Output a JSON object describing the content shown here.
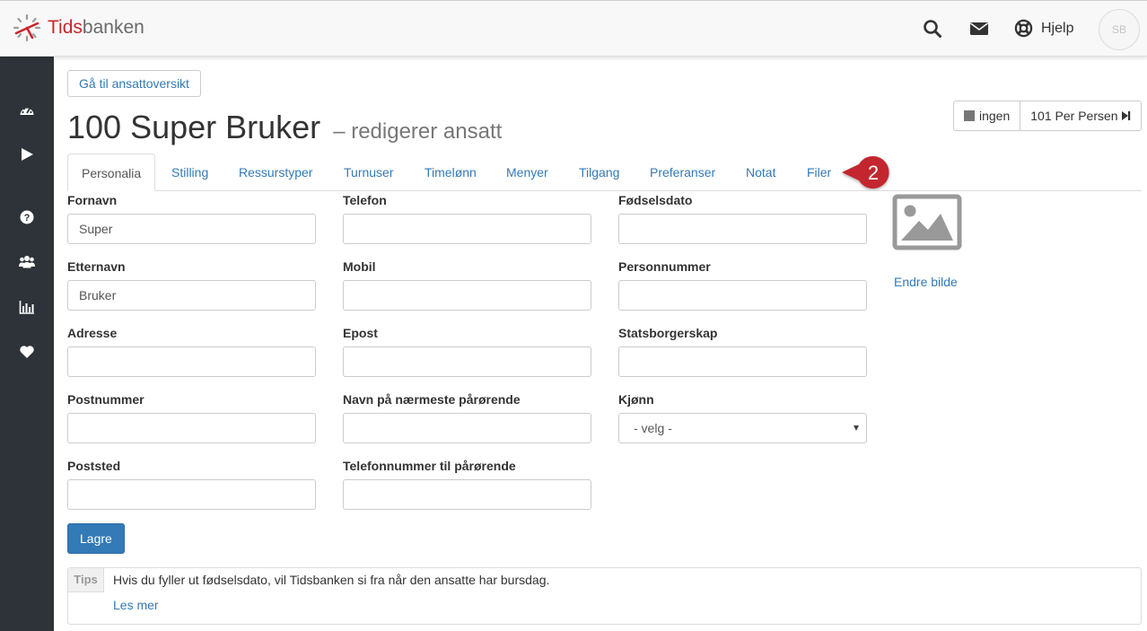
{
  "brand": {
    "name_part1": "Tids",
    "name_part2": "banken",
    "accent": "#c9252c"
  },
  "header": {
    "search_icon": "search-icon",
    "mail_icon": "envelope-icon",
    "help_icon": "lifebuoy-icon",
    "help_label": "Hjelp",
    "avatar_initials": "SB"
  },
  "sidebar": {
    "items": [
      {
        "icon": "dashboard-icon"
      },
      {
        "icon": "play-icon"
      },
      {
        "icon": "question-icon"
      },
      {
        "icon": "users-icon"
      },
      {
        "icon": "bar-chart-icon"
      },
      {
        "icon": "heart-icon"
      }
    ],
    "background": "#2d3338"
  },
  "page": {
    "back_button": "Gå til ansattoversikt",
    "title": "100 Super Bruker",
    "subtitle": "– redigerer ansatt",
    "nav_prev": "ingen",
    "nav_next": "101 Per Persen"
  },
  "tabs": [
    {
      "label": "Personalia",
      "active": true
    },
    {
      "label": "Stilling"
    },
    {
      "label": "Ressurstyper"
    },
    {
      "label": "Turnuser"
    },
    {
      "label": "Timelønn"
    },
    {
      "label": "Menyer"
    },
    {
      "label": "Tilgang"
    },
    {
      "label": "Preferanser"
    },
    {
      "label": "Notat"
    },
    {
      "label": "Filer"
    }
  ],
  "callout": {
    "number": "2",
    "color": "#c3262e"
  },
  "form": {
    "fornavn": {
      "label": "Fornavn",
      "value": "Super"
    },
    "etternavn": {
      "label": "Etternavn",
      "value": "Bruker"
    },
    "adresse": {
      "label": "Adresse",
      "value": ""
    },
    "postnummer": {
      "label": "Postnummer",
      "value": ""
    },
    "poststed": {
      "label": "Poststed",
      "value": ""
    },
    "telefon": {
      "label": "Telefon",
      "value": ""
    },
    "mobil": {
      "label": "Mobil",
      "value": ""
    },
    "epost": {
      "label": "Epost",
      "value": ""
    },
    "parorende": {
      "label": "Navn på nærmeste pårørende",
      "value": ""
    },
    "parorende_tlf": {
      "label": "Telefonnummer til pårørende",
      "value": ""
    },
    "fodselsdato": {
      "label": "Fødselsdato",
      "value": ""
    },
    "personnummer": {
      "label": "Personnummer",
      "value": ""
    },
    "statsborgerskap": {
      "label": "Statsborgerskap",
      "value": ""
    },
    "kjonn": {
      "label": "Kjønn",
      "value": "- velg -"
    }
  },
  "image": {
    "change_label": "Endre bilde"
  },
  "save_button": "Lagre",
  "tips": {
    "tag": "Tips",
    "text": "Hvis du fyller ut fødselsdato, vil Tidsbanken si fra når den ansatte har bursdag.",
    "link": "Les mer"
  }
}
